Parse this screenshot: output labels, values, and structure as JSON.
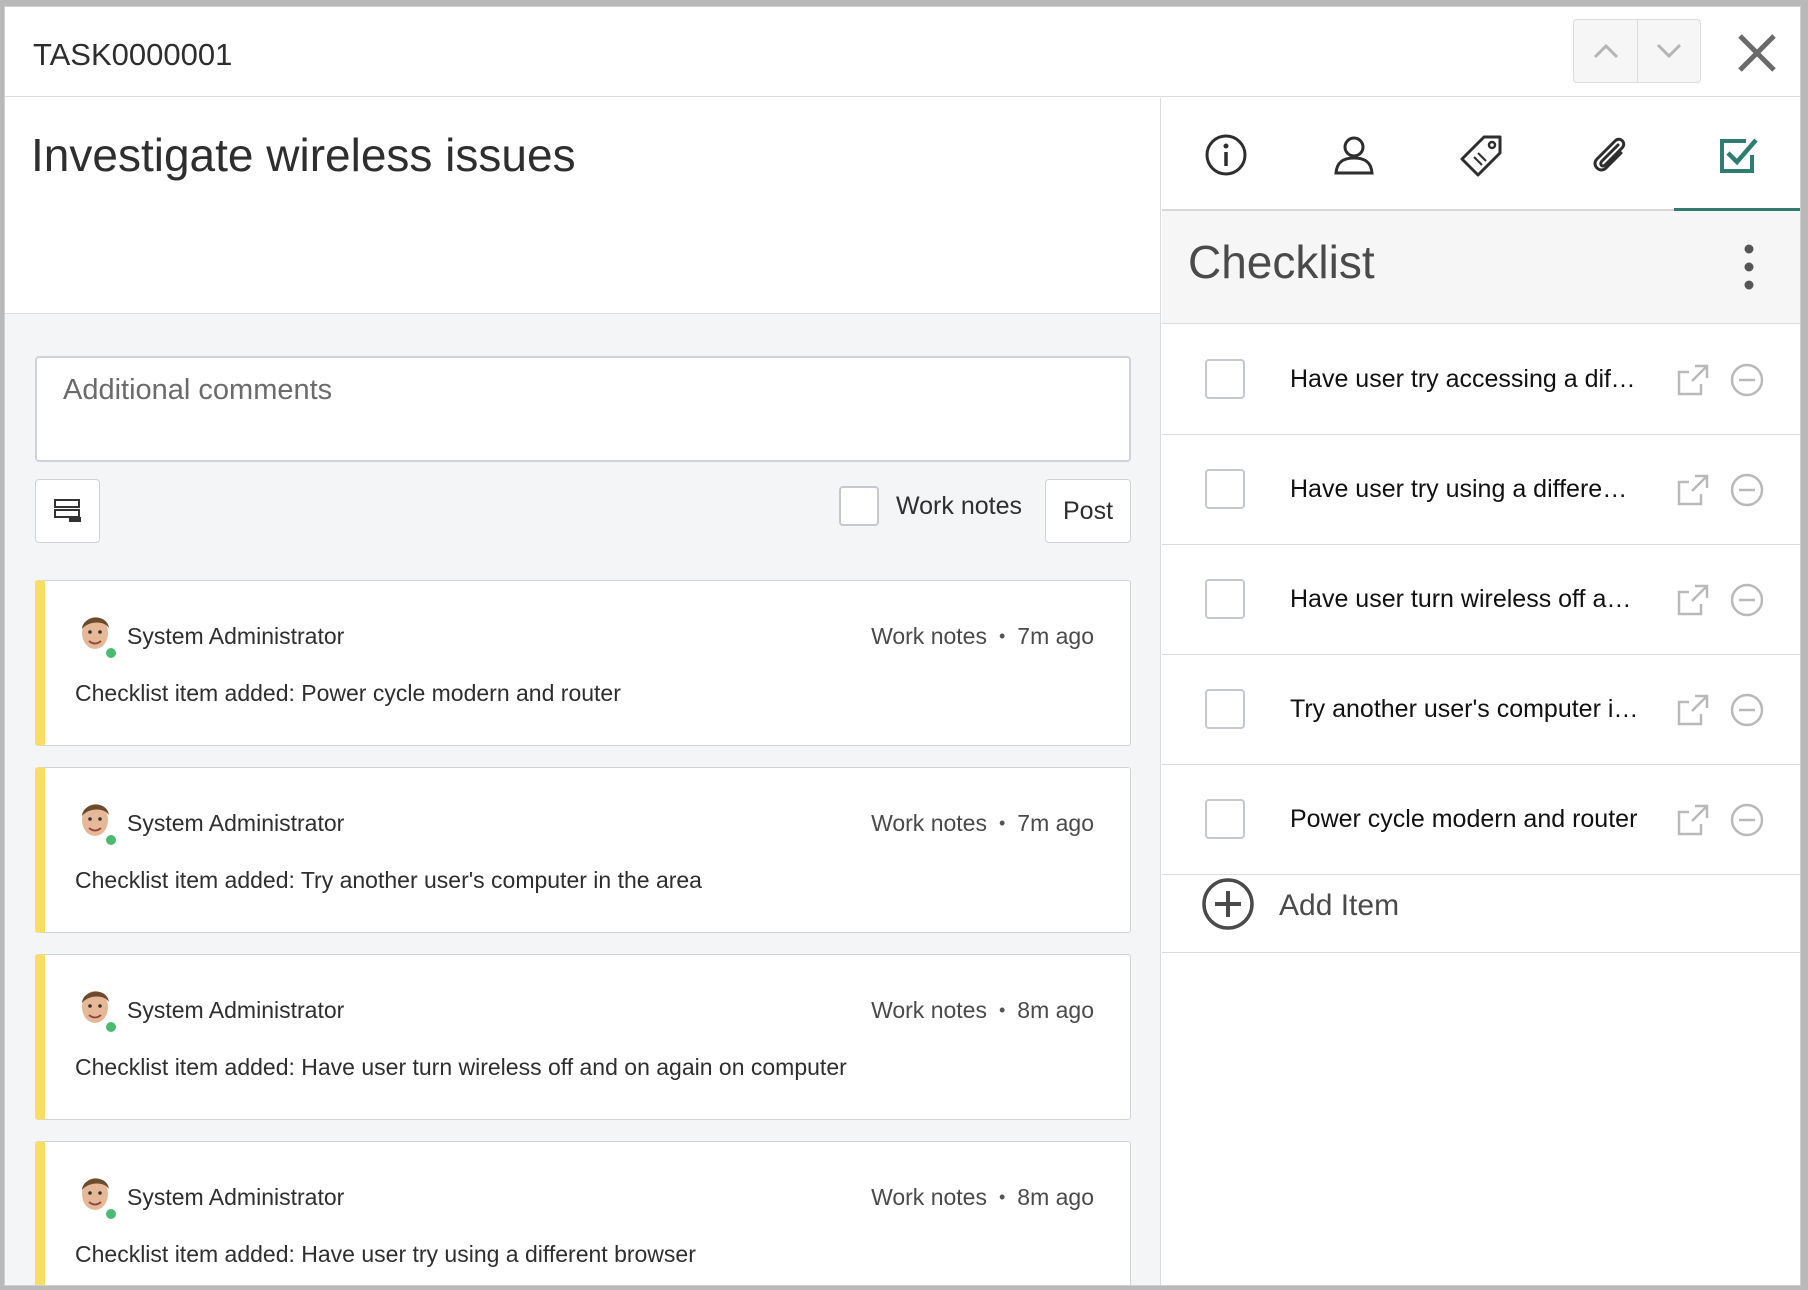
{
  "header": {
    "task_number": "TASK0000001"
  },
  "record": {
    "short_description": "Investigate wireless issues"
  },
  "composer": {
    "placeholder": "Additional comments",
    "work_notes_label": "Work notes",
    "post_label": "Post"
  },
  "feed": [
    {
      "author": "System Administrator",
      "type": "Work notes",
      "time": "7m ago",
      "text": "Checklist item added: Power cycle modern and router"
    },
    {
      "author": "System Administrator",
      "type": "Work notes",
      "time": "7m ago",
      "text": "Checklist item added: Try another user's computer in the area"
    },
    {
      "author": "System Administrator",
      "type": "Work notes",
      "time": "8m ago",
      "text": "Checklist item added: Have user turn wireless off and on again on computer"
    },
    {
      "author": "System Administrator",
      "type": "Work notes",
      "time": "8m ago",
      "text": "Checklist item added: Have user try using a different browser"
    }
  ],
  "sidebar": {
    "tabs": [
      {
        "icon": "info-icon"
      },
      {
        "icon": "user-icon"
      },
      {
        "icon": "tag-icon"
      },
      {
        "icon": "paperclip-icon"
      },
      {
        "icon": "checkbox-icon",
        "active": true
      }
    ],
    "checklist_title": "Checklist",
    "items": [
      {
        "label": "Have user try accessing a diff…"
      },
      {
        "label": "Have user try using a differen…"
      },
      {
        "label": "Have user turn wireless off an…"
      },
      {
        "label": "Try another user's computer i…"
      },
      {
        "label": "Power cycle modern and router"
      }
    ],
    "add_item_label": "Add Item"
  },
  "colors": {
    "accent": "#2e7d70",
    "work_note_stripe": "#f9de63",
    "presence": "#4cbb72"
  }
}
